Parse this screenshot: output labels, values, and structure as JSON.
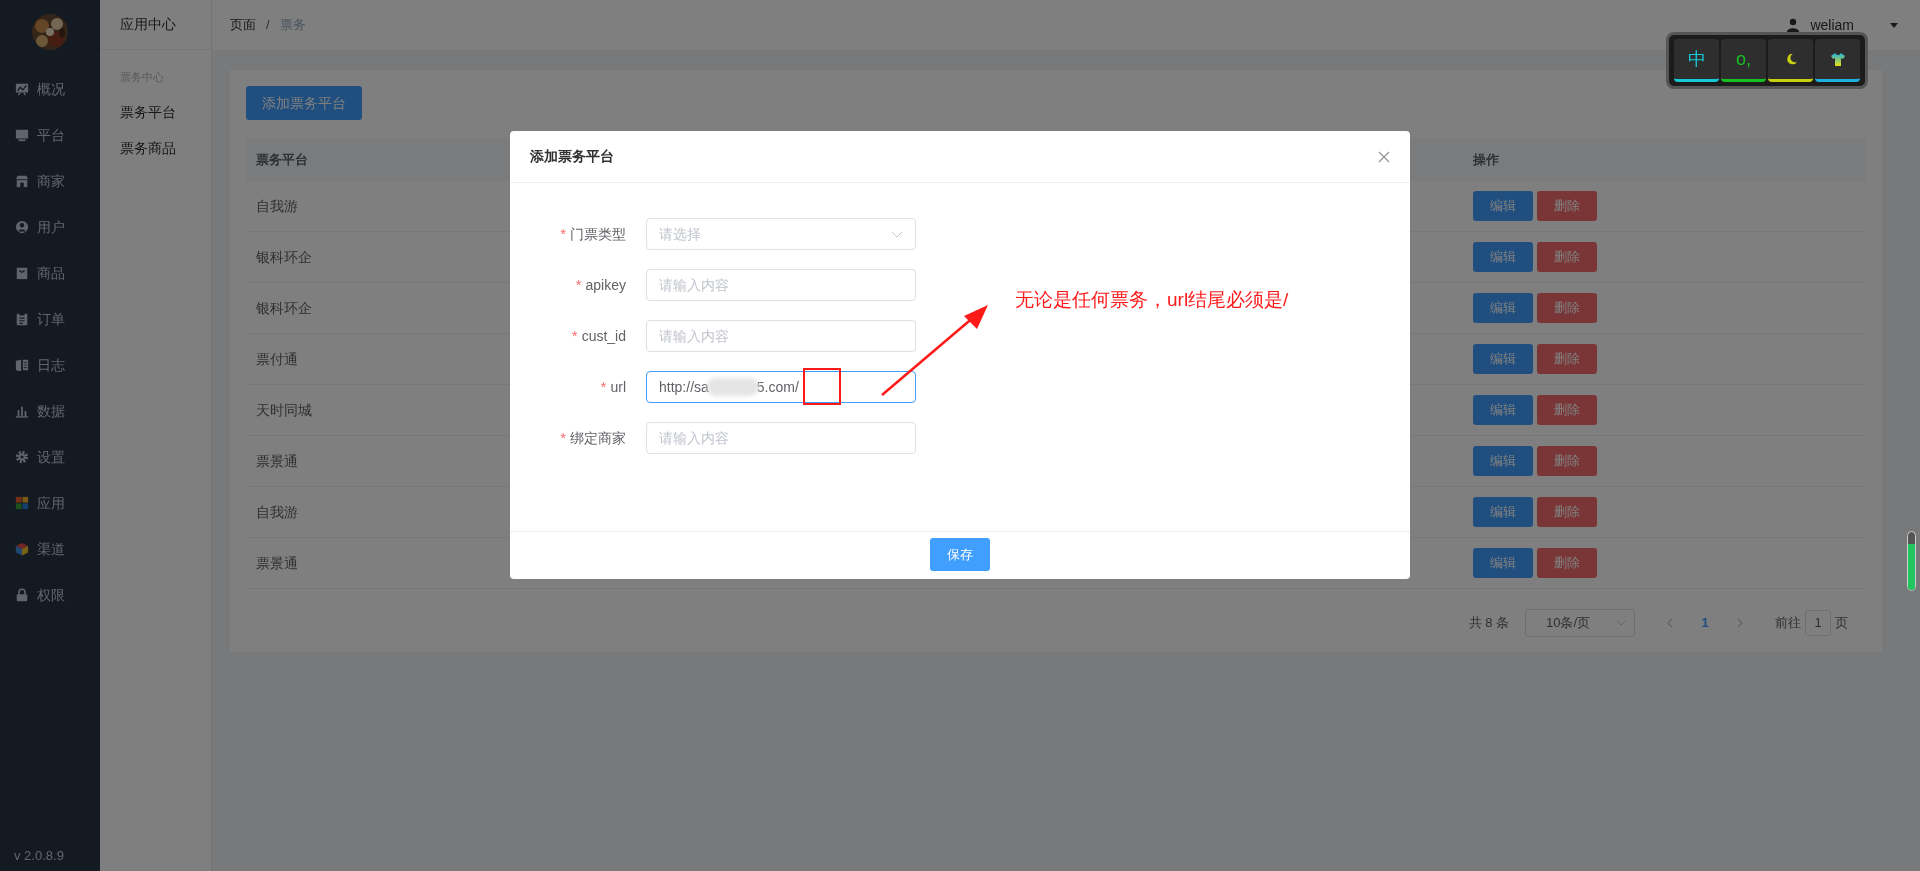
{
  "sidebar": {
    "items": [
      {
        "label": "概况"
      },
      {
        "label": "平台"
      },
      {
        "label": "商家"
      },
      {
        "label": "用户"
      },
      {
        "label": "商品"
      },
      {
        "label": "订单"
      },
      {
        "label": "日志"
      },
      {
        "label": "数据"
      },
      {
        "label": "设置"
      },
      {
        "label": "应用"
      },
      {
        "label": "渠道"
      },
      {
        "label": "权限"
      }
    ],
    "version": "v 2.0.8.9"
  },
  "submenu": {
    "title": "应用中心",
    "group": "票务中心",
    "items": [
      "票务平台",
      "票务商品"
    ]
  },
  "header": {
    "breadcrumb": [
      "页面",
      "票务"
    ],
    "separator": "/",
    "user": "weliam"
  },
  "toolbar_widget": {
    "keys": [
      {
        "label": "中",
        "color": "#16c8d8"
      },
      {
        "label": "o,",
        "color": "#16c020"
      },
      {
        "color": "#c8d010"
      },
      {
        "color": "#20b0e0"
      }
    ]
  },
  "add_button": "添加票务平台",
  "table": {
    "columns": [
      "票务平台",
      "操作"
    ],
    "rows": [
      {
        "name": "自我游",
        "actions": [
          "编辑",
          "删除"
        ]
      },
      {
        "name": "银科环企",
        "actions": [
          "编辑",
          "删除"
        ]
      },
      {
        "name": "银科环企",
        "actions": [
          "编辑",
          "删除"
        ]
      },
      {
        "name": "票付通",
        "actions": [
          "编辑",
          "删除"
        ]
      },
      {
        "name": "天时同城",
        "actions": [
          "编辑",
          "删除"
        ]
      },
      {
        "name": "票景通",
        "actions": [
          "编辑",
          "删除"
        ]
      },
      {
        "name": "自我游",
        "actions": [
          "编辑",
          "删除"
        ]
      },
      {
        "name": "票景通",
        "actions": [
          "编辑",
          "删除"
        ]
      }
    ]
  },
  "pagination": {
    "total": "共 8 条",
    "page_size": "10条/页",
    "pages": [
      {
        "label": "1",
        "selected": true
      }
    ],
    "goto_label": "前往",
    "goto_value": "1",
    "goto_suffix": "页"
  },
  "dialog": {
    "title": "添加票务平台",
    "fields": [
      {
        "label": "门票类型",
        "marker": "*",
        "kind": "select",
        "placeholder": "请选择",
        "focused": false
      },
      {
        "label": "apikey",
        "marker": "*",
        "kind": "input",
        "placeholder": "请输入内容",
        "focused": false
      },
      {
        "label": "cust_id",
        "marker": "*",
        "kind": "input",
        "placeholder": "请输入内容",
        "focused": false
      },
      {
        "label": "url",
        "marker": "*",
        "kind": "masked",
        "value_start": "http://sa",
        "value_end": "5.com/",
        "focused": true
      },
      {
        "label": "绑定商家",
        "marker": "*",
        "kind": "input",
        "placeholder": "请输入内容",
        "focused": false
      }
    ],
    "save_button": "保存"
  },
  "annotation": {
    "text": "无论是任何票务，url结尾必须是/"
  }
}
